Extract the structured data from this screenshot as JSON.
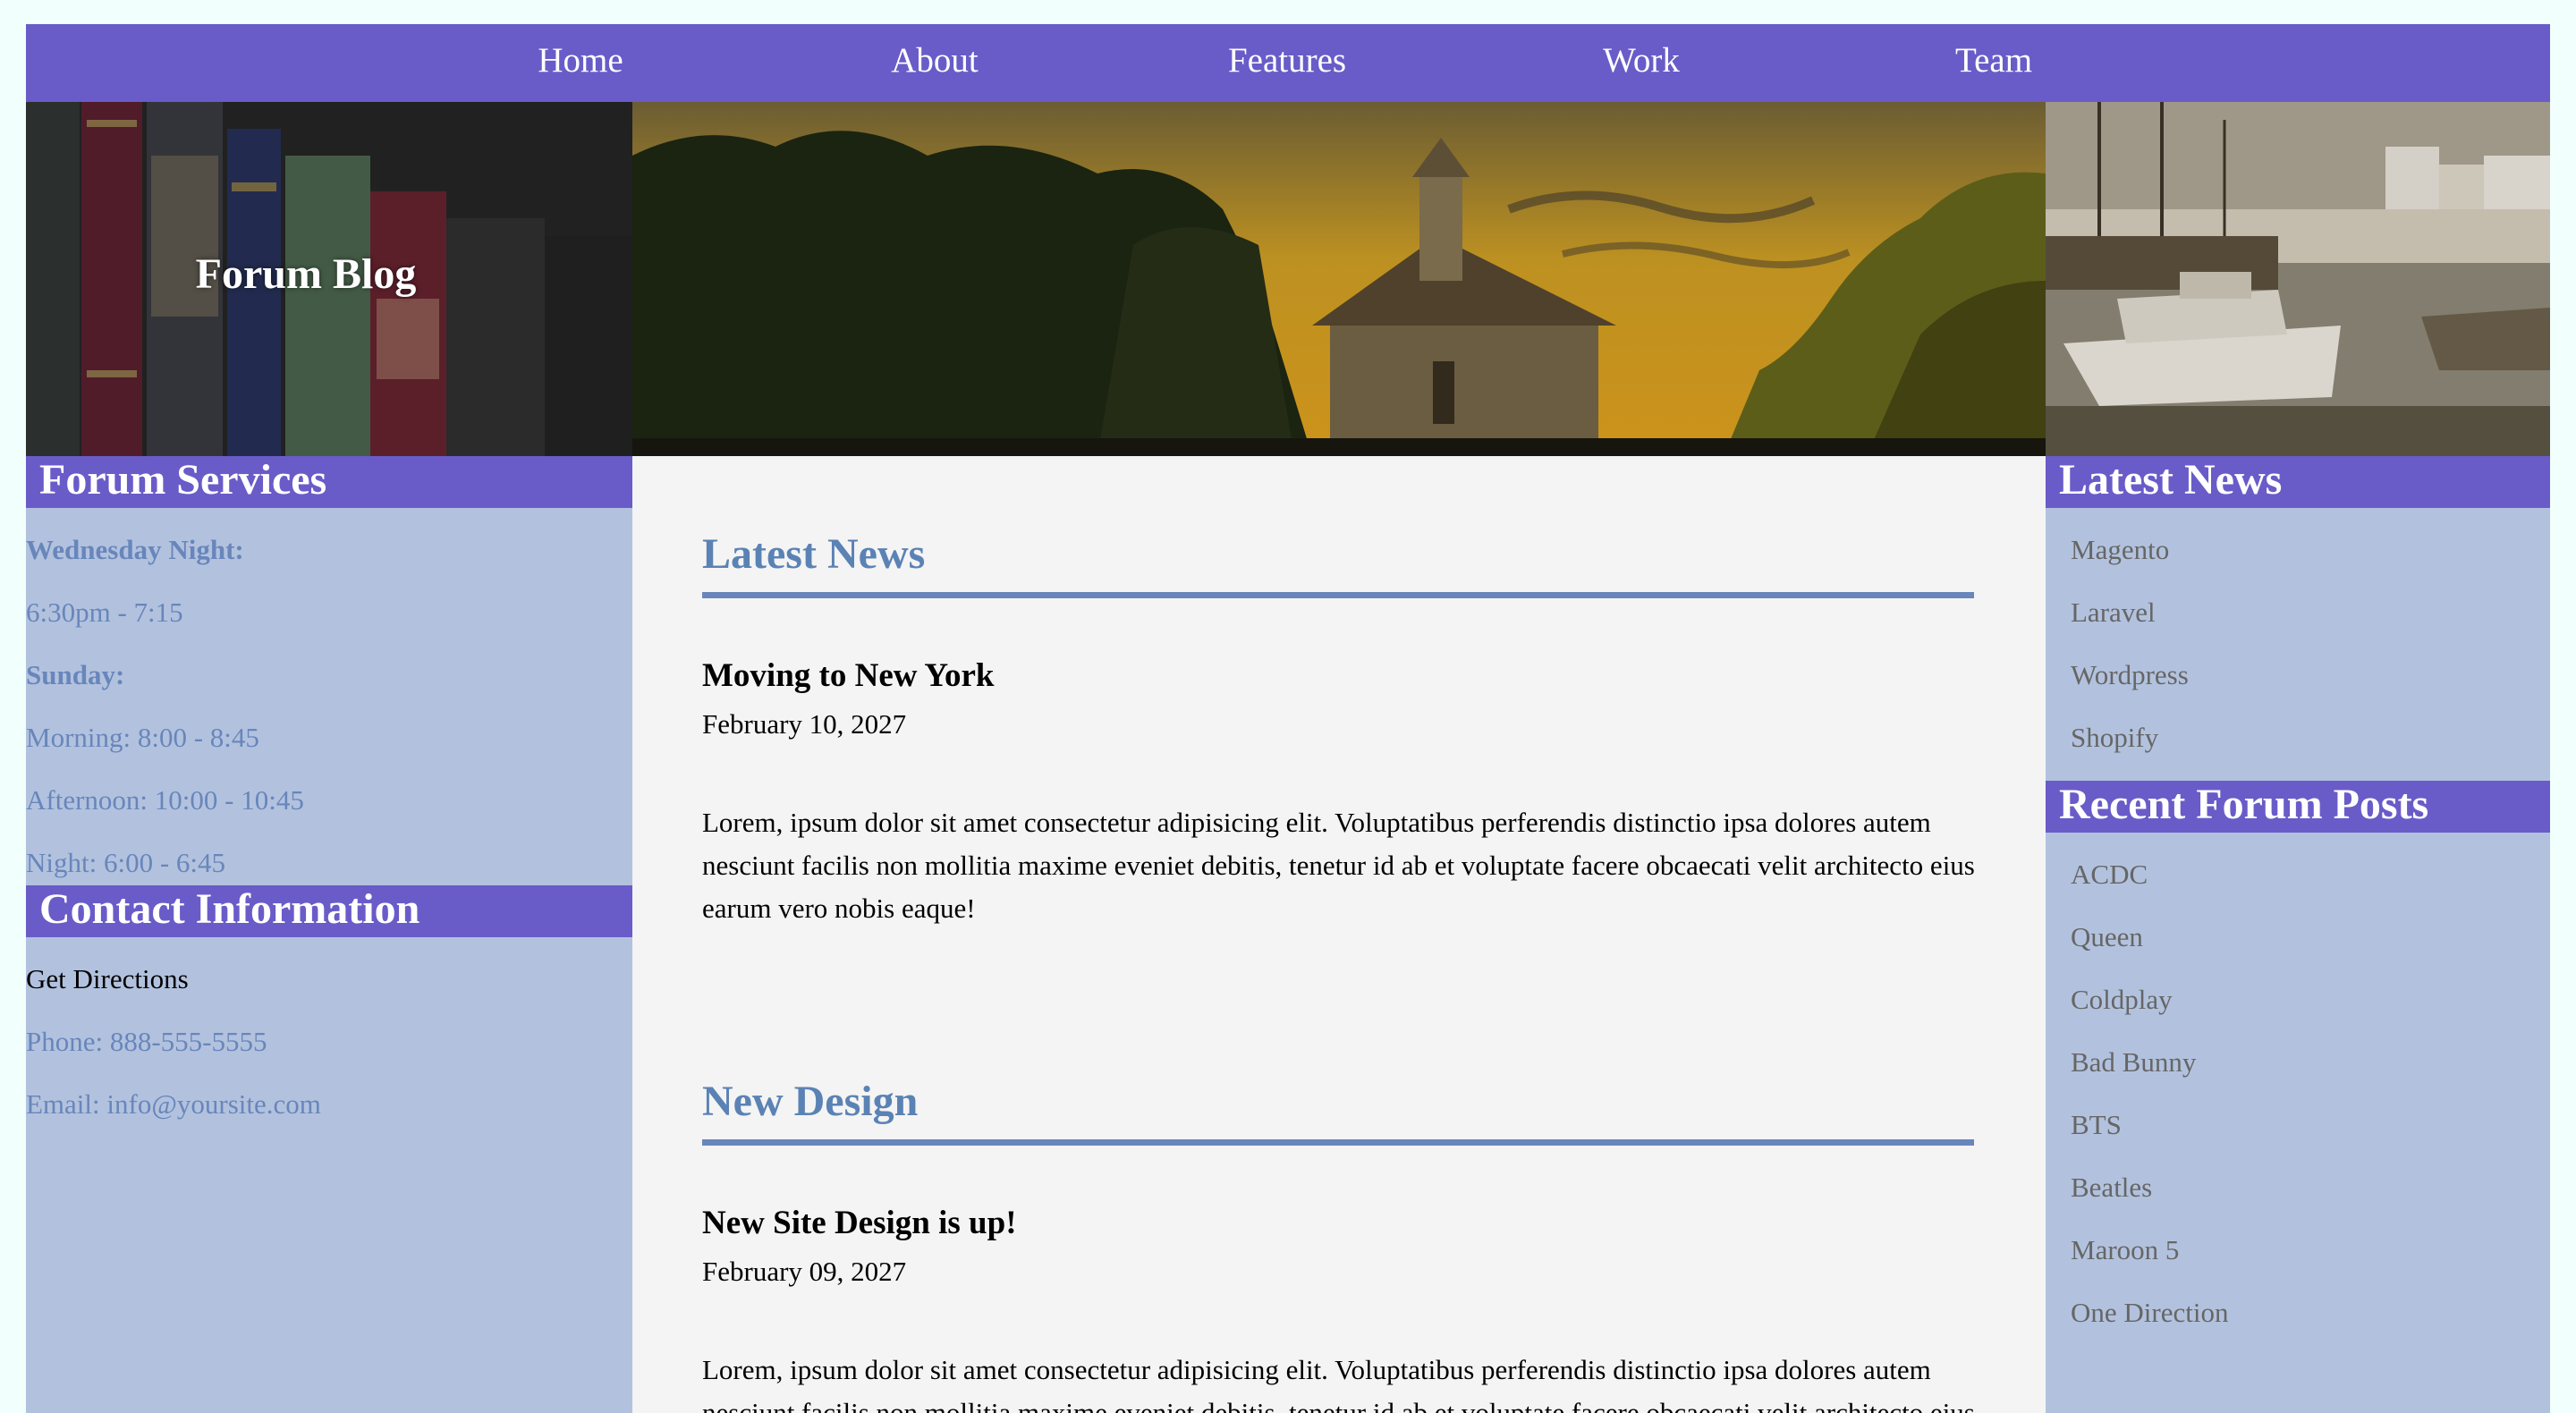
{
  "nav": {
    "items": [
      {
        "label": "Home"
      },
      {
        "label": "About"
      },
      {
        "label": "Features"
      },
      {
        "label": "Work"
      },
      {
        "label": "Team"
      }
    ]
  },
  "banner": {
    "title": "Forum Blog"
  },
  "left": {
    "services_heading": "Forum Services",
    "services": [
      {
        "text": "Wednesday Night:"
      },
      {
        "text": "6:30pm - 7:15"
      },
      {
        "text": "Sunday:"
      },
      {
        "text": "Morning: 8:00 - 8:45"
      },
      {
        "text": "Afternoon: 10:00 - 10:45"
      },
      {
        "text": "Night: 6:00 - 6:45"
      }
    ],
    "contact_heading": "Contact Information",
    "contact": [
      {
        "text": "Get Directions"
      },
      {
        "text": "Phone: 888-555-5555"
      },
      {
        "text": "Email: info@yoursite.com"
      }
    ]
  },
  "main": {
    "posts": [
      {
        "section_title": "Latest News",
        "heading": "Moving to New York",
        "date": "February 10, 2027",
        "body": "Lorem, ipsum dolor sit amet consectetur adipisicing elit. Voluptatibus perferendis distinctio ipsa dolores autem nesciunt facilis non mollitia maxime eveniet debitis, tenetur id ab et voluptate facere obcaecati velit architecto eius earum vero nobis eaque!"
      },
      {
        "section_title": "New Design",
        "heading": "New Site Design is up!",
        "date": "February 09, 2027",
        "body": "Lorem, ipsum dolor sit amet consectetur adipisicing elit. Voluptatibus perferendis distinctio ipsa dolores autem nesciunt facilis non mollitia maxime eveniet debitis, tenetur id ab et voluptate facere obcaecati velit architecto eius earum vero nobis eaque!"
      }
    ]
  },
  "right": {
    "news_heading": "Latest News",
    "news": [
      {
        "label": "Magento"
      },
      {
        "label": "Laravel"
      },
      {
        "label": "Wordpress"
      },
      {
        "label": "Shopify"
      }
    ],
    "posts_heading": "Recent Forum Posts",
    "forum_posts": [
      {
        "label": "ACDC"
      },
      {
        "label": "Queen"
      },
      {
        "label": "Coldplay"
      },
      {
        "label": "Bad Bunny"
      },
      {
        "label": "BTS"
      },
      {
        "label": "Beatles"
      },
      {
        "label": "Maroon 5"
      },
      {
        "label": "One Direction"
      }
    ]
  },
  "colors": {
    "nav_bg": "#695cc8",
    "sidebar_bg": "#b2c2de",
    "main_bg": "#f4f4f4",
    "accent_text": "#6886bb",
    "section_title": "#5b82b4"
  }
}
